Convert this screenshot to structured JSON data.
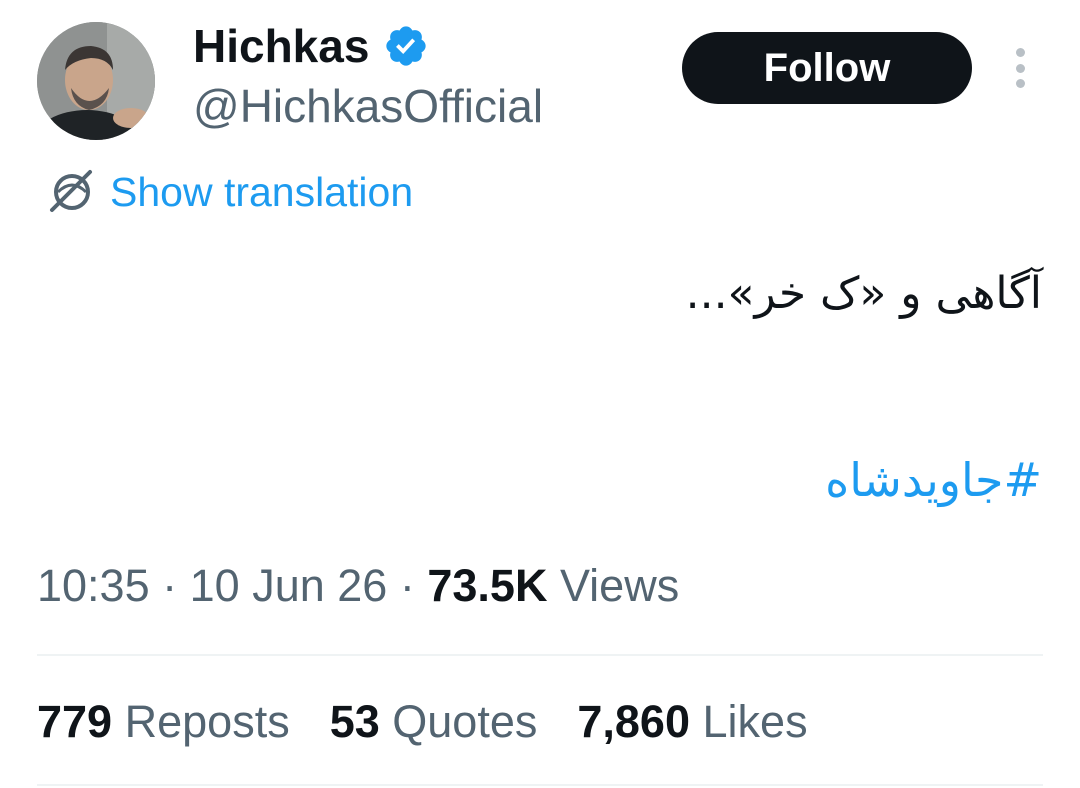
{
  "author": {
    "display_name": "Hichkas",
    "handle": "@HichkasOfficial",
    "verified": true
  },
  "actions": {
    "follow_label": "Follow",
    "translate_label": "Show translation"
  },
  "icons": {
    "verified": "verified-badge-icon",
    "translate": "globe-translate-icon",
    "more": "more-vertical-icon"
  },
  "tweet": {
    "text": "آگاهی و «ک  خر»...",
    "hashtag": "#جاویدشاه"
  },
  "meta": {
    "time": "10:35",
    "separator": "·",
    "date": "10 Jun 26",
    "views_count": "73.5K",
    "views_label": "Views"
  },
  "stats": {
    "reposts_count": "779",
    "reposts_label": "Reposts",
    "quotes_count": "53",
    "quotes_label": "Quotes",
    "likes_count": "7,860",
    "likes_label": "Likes"
  },
  "colors": {
    "accent": "#1d9bf0",
    "text": "#0f1419",
    "secondary": "#536471",
    "button": "#0f1419",
    "divider": "#eff3f4"
  }
}
